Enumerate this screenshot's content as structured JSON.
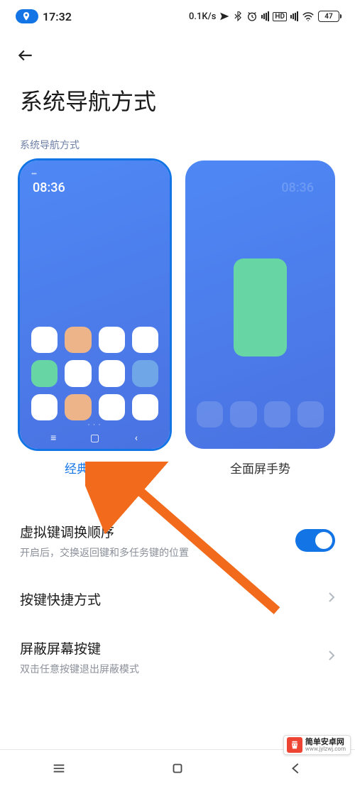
{
  "status": {
    "time": "17:32",
    "net_speed": "0.1K/s",
    "hd_badge": "HD",
    "battery_pct": "47"
  },
  "page": {
    "title": "系统导航方式",
    "section_label": "系统导航方式"
  },
  "options": [
    {
      "label": "经典导航键",
      "selected": true,
      "preview_time": "08:36"
    },
    {
      "label": "全面屏手势",
      "selected": false,
      "preview_time": "08:36"
    }
  ],
  "settings": {
    "swap": {
      "title": "虚拟键调换顺序",
      "sub": "开启后，交换返回键和多任务键的位置",
      "on": true
    },
    "shortcut": {
      "title": "按键快捷方式"
    },
    "block": {
      "title": "屏蔽屏幕按键",
      "sub": "双击任意按键退出屏蔽模式"
    }
  },
  "nav_icons": {
    "menu": "menu",
    "home": "home",
    "back": "back"
  },
  "watermark": {
    "title": "简单安卓网",
    "url": "www.jylzwj.com"
  }
}
